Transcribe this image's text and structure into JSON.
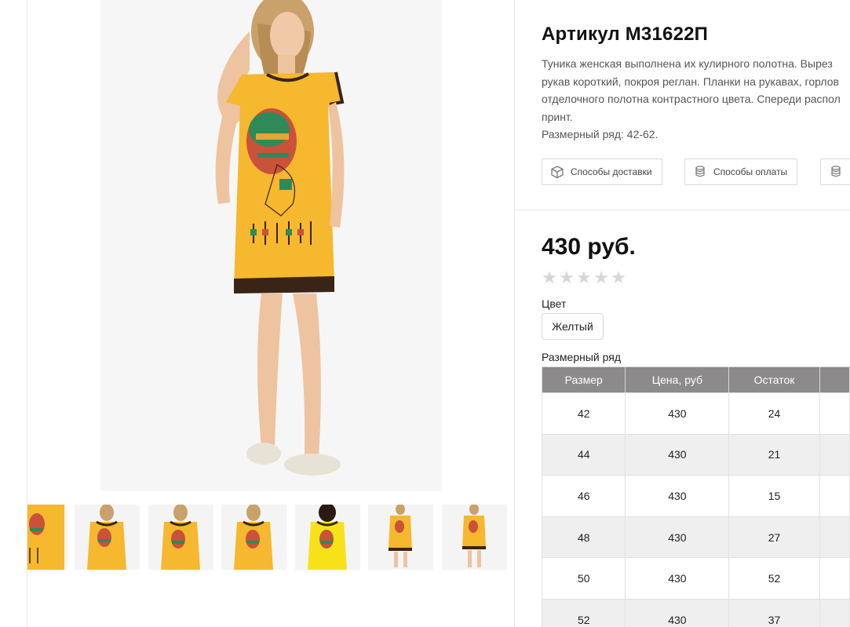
{
  "product": {
    "title": "Артикул М31622П",
    "description_lines": [
      "Туника женская выполнена их кулирного полотна. Вырез",
      "рукав короткий, покроя реглан. Планки на рукавах, горлов",
      "отделочного полотна контрастного цвета. Спереди распол",
      "принт."
    ],
    "size_range_text": "Размерный ряд: 42-62.",
    "price": "430 руб.",
    "rating_stars": 0,
    "rating_max": 5
  },
  "info_buttons": {
    "delivery": {
      "label": "Способы доставки",
      "icon": "box-icon"
    },
    "payment": {
      "label": "Способы оплаты",
      "icon": "coins-icon"
    },
    "third": {
      "label": "",
      "icon": "coins-icon"
    }
  },
  "color": {
    "label": "Цвет",
    "selected": "Желтый"
  },
  "sizes": {
    "label": "Размерный ряд",
    "headers": [
      "Размер",
      "Цена, руб",
      "Остаток",
      ""
    ],
    "rows": [
      [
        "42",
        "430",
        "24",
        ""
      ],
      [
        "44",
        "430",
        "21",
        ""
      ],
      [
        "46",
        "430",
        "15",
        ""
      ],
      [
        "48",
        "430",
        "27",
        ""
      ],
      [
        "50",
        "430",
        "52",
        ""
      ],
      [
        "52",
        "430",
        "37",
        ""
      ]
    ]
  },
  "colors": {
    "garment": "#f5b82e",
    "trim": "#3a2418",
    "table_header": "#8c8a8b",
    "star": "#d6d6d6"
  },
  "gallery": {
    "thumbnail_count": 7
  }
}
